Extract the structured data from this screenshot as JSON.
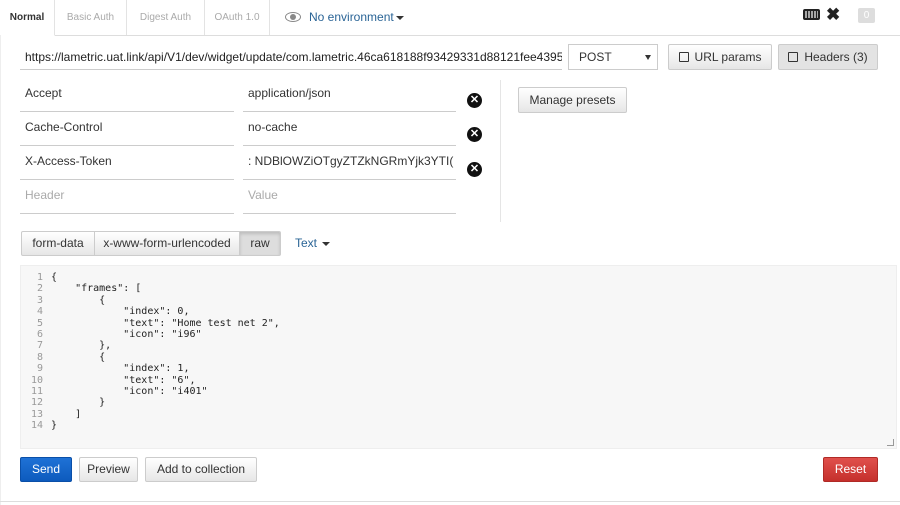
{
  "tabs": [
    {
      "label": "Normal",
      "active": true
    },
    {
      "label": "Basic Auth",
      "active": false
    },
    {
      "label": "Digest Auth",
      "active": false
    },
    {
      "label": "OAuth 1.0",
      "active": false
    }
  ],
  "environment": {
    "label": "No environment",
    "icon": "eye-icon"
  },
  "toolbar_right": {
    "keyboard_icon": "keyboard-icon",
    "tools_icon": "tools-icon",
    "count": "0"
  },
  "request": {
    "url": "https://lametric.uat.link/api/V1/dev/widget/update/com.lametric.46ca618188f93429331d88121fee4395",
    "method": "POST",
    "url_params_label": "URL params",
    "headers_label": "Headers (3)"
  },
  "headers": [
    {
      "key": "Accept",
      "value": "application/json"
    },
    {
      "key": "Cache-Control",
      "value": "no-cache"
    },
    {
      "key": "X-Access-Token",
      "value": ": NDBlOWZiOTgyZTZkNGRmYjk3YTI("
    }
  ],
  "new_header": {
    "key_placeholder": "Header",
    "value_placeholder": "Value"
  },
  "manage_presets_label": "Manage presets",
  "body_modes": [
    {
      "label": "form-data",
      "active": false
    },
    {
      "label": "x-www-form-urlencoded",
      "active": false
    },
    {
      "label": "raw",
      "active": true
    }
  ],
  "raw_type": "Text",
  "editor": {
    "line_numbers": "1\n2\n3\n4\n5\n6\n7\n8\n9\n10\n11\n12\n13\n14",
    "code": "{\n    \"frames\": [\n        {\n            \"index\": 0,\n            \"text\": \"Home test net 2\",\n            \"icon\": \"i96\"\n        },\n        {\n            \"index\": 1,\n            \"text\": \"6\",\n            \"icon\": \"i401\"\n        }\n    ]\n}"
  },
  "actions": {
    "send": "Send",
    "preview": "Preview",
    "add_to_collection": "Add to collection",
    "reset": "Reset"
  },
  "colors": {
    "accent": "#0d5bbd",
    "danger": "#c9302c",
    "link": "#2a6496"
  }
}
